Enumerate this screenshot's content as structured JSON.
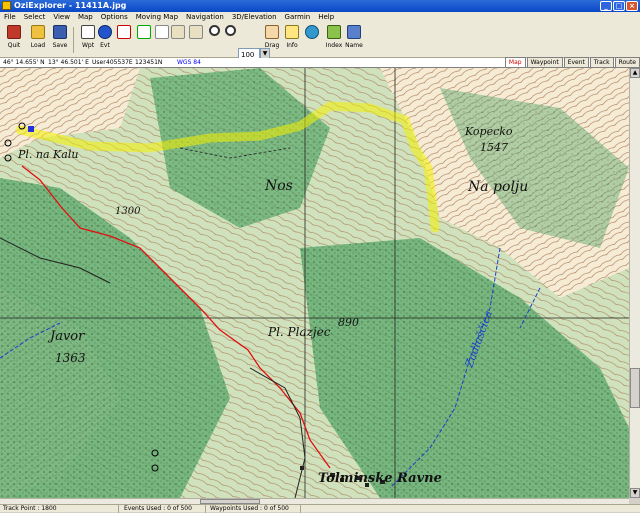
{
  "window": {
    "title": "OziExplorer - 11411A.jpg"
  },
  "menu": [
    "File",
    "Select",
    "View",
    "Map",
    "Options",
    "Moving Map",
    "Navigation",
    "3D/Elevation",
    "Garmin",
    "Help"
  ],
  "toolbar": {
    "quit": "Quit",
    "load": "Load",
    "save": "Save",
    "wpt": "Wpt",
    "evt": "Evt",
    "zoom": "100",
    "drag": "Drag",
    "info": "Info",
    "index": "Index",
    "name": "Name"
  },
  "infobar": {
    "lat": "46° 14.655' N",
    "lon": "13° 46.501' E",
    "user_label": "User",
    "east": "405537E",
    "north": "123451N",
    "datum": "WGS 84"
  },
  "view_tabs": [
    "Map",
    "Waypoint",
    "Event",
    "Track",
    "Route"
  ],
  "map": {
    "labels": [
      "Pl. na Kalu",
      "Nos",
      "Kopecko",
      "1547",
      "Na polju",
      "1300",
      "Javor",
      "1363",
      "Pl. Plazjec",
      "890",
      "Zadlaščica",
      "Tolminske Ravne"
    ]
  },
  "status": {
    "track_point": "Track Point : 1800",
    "events": "Events Used : 0 of 500",
    "waypoints": "Waypoints Used : 0 of 500"
  }
}
